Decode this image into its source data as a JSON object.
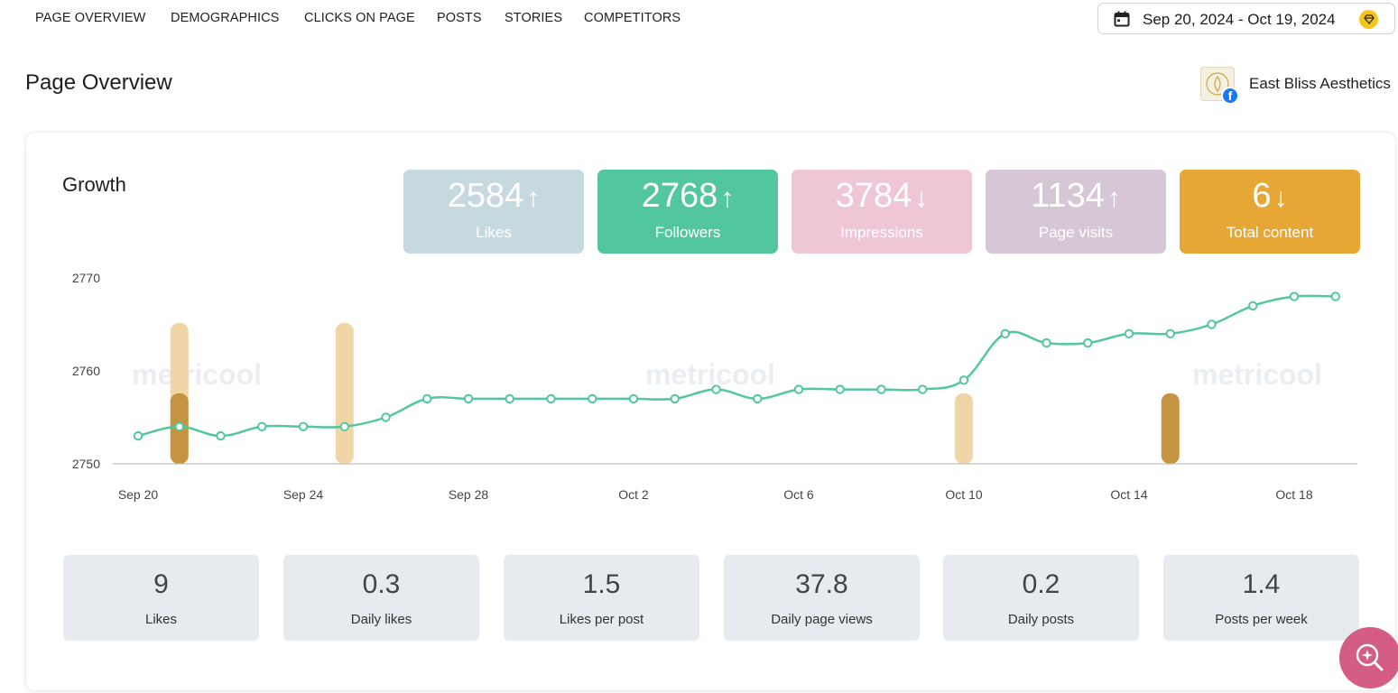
{
  "nav": {
    "tabs": [
      "PAGE OVERVIEW",
      "DEMOGRAPHICS",
      "CLICKS ON PAGE",
      "POSTS",
      "STORIES",
      "COMPETITORS"
    ]
  },
  "date_range": {
    "label": "Sep 20, 2024 - Oct 19, 2024",
    "icon": "calendar-icon",
    "badge_icon": "premium-gem-icon"
  },
  "page": {
    "title": "Page Overview"
  },
  "account": {
    "name": "East Bliss Aesthetics",
    "network_icon": "facebook-icon"
  },
  "growth": {
    "title": "Growth",
    "kpis": [
      {
        "value": "2584",
        "label": "Likes",
        "trend": "up",
        "arrow": "↑",
        "color": "#c7d9e0"
      },
      {
        "value": "2768",
        "label": "Followers",
        "trend": "up",
        "arrow": "↑",
        "color": "#52c79d"
      },
      {
        "value": "3784",
        "label": "Impressions",
        "trend": "down",
        "arrow": "↓",
        "color": "#eec6d5"
      },
      {
        "value": "1134",
        "label": "Page visits",
        "trend": "up",
        "arrow": "↑",
        "color": "#d7c6d6"
      },
      {
        "value": "6",
        "label": "Total content",
        "trend": "down",
        "arrow": "↓",
        "color": "#e7a735"
      }
    ]
  },
  "chart_data": {
    "type": "line",
    "watermark": "metricool",
    "yticks": [
      2750,
      2760,
      2770
    ],
    "ylim": [
      2750,
      2772
    ],
    "x_tick_labels": [
      "Sep 20",
      "Sep 24",
      "Sep 28",
      "Oct 2",
      "Oct 6",
      "Oct 10",
      "Oct 14",
      "Oct 18"
    ],
    "x_tick_day_index": [
      0,
      4,
      8,
      12,
      16,
      20,
      24,
      28
    ],
    "grid": false,
    "series": [
      {
        "name": "Followers",
        "color": "#52c79d",
        "values": [
          2753,
          2754,
          2753,
          2754,
          2754,
          2754,
          2755,
          2757,
          2757,
          2757,
          2757,
          2757,
          2757,
          2757,
          2758,
          2757,
          2758,
          2758,
          2758,
          2758,
          2759,
          2764,
          2763,
          2763,
          2764,
          2764,
          2765,
          2767,
          2768,
          2768
        ]
      }
    ],
    "content_bars": {
      "colors": {
        "light": "#f0d6a6",
        "dark": "#c49441"
      },
      "values_light": [
        0,
        2,
        0,
        0,
        0,
        2,
        0,
        0,
        0,
        0,
        0,
        0,
        0,
        0,
        0,
        0,
        0,
        0,
        0,
        0,
        1,
        0,
        0,
        0,
        0,
        0,
        0,
        0,
        0,
        0
      ],
      "values_dark": [
        0,
        1,
        0,
        0,
        0,
        0,
        0,
        0,
        0,
        0,
        0,
        0,
        0,
        0,
        0,
        0,
        0,
        0,
        0,
        0,
        0,
        0,
        0,
        0,
        0,
        1,
        0,
        0,
        0,
        0
      ],
      "max": 2
    }
  },
  "stats": [
    {
      "value": "9",
      "label": "Likes"
    },
    {
      "value": "0.3",
      "label": "Daily likes"
    },
    {
      "value": "1.5",
      "label": "Likes per post"
    },
    {
      "value": "37.8",
      "label": "Daily page views"
    },
    {
      "value": "0.2",
      "label": "Daily posts"
    },
    {
      "value": "1.4",
      "label": "Posts per week"
    }
  ],
  "assistant": {
    "icon": "ai-search-icon"
  }
}
